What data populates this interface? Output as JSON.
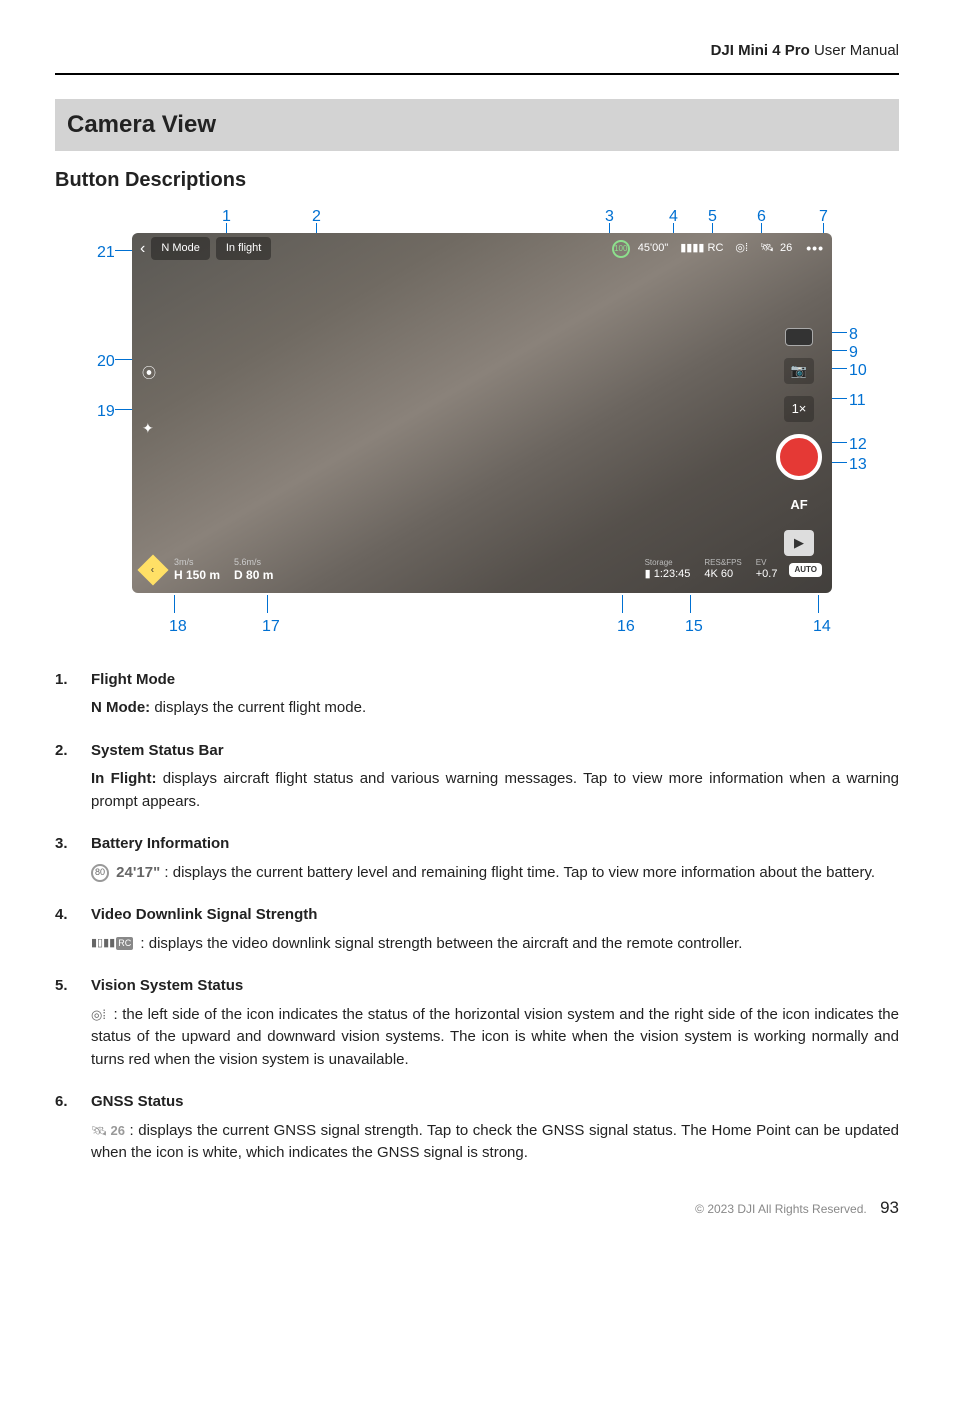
{
  "header": {
    "product": "DJI Mini 4 Pro",
    "label": "User Manual"
  },
  "section_title": "Camera View",
  "sub_title": "Button Descriptions",
  "screenshot": {
    "mode": "N Mode",
    "status": "In flight",
    "battery_pct": "100",
    "battery_time": "45'00\"",
    "gnss": "26",
    "zoom": "1×",
    "af": "AF",
    "speed_v": "3m/s",
    "speed_h": "5.6m/s",
    "height": "H 150 m",
    "distance": "D 80 m",
    "storage_lbl": "Storage",
    "storage_val": "1:23:45",
    "resfps_lbl": "RES&FPS",
    "resfps_val": "4K 60",
    "ev_lbl": "EV",
    "ev_val": "+0.7",
    "auto": "AUTO"
  },
  "callouts": {
    "c1": "1",
    "c2": "2",
    "c3": "3",
    "c4": "4",
    "c5": "5",
    "c6": "6",
    "c7": "7",
    "c8": "8",
    "c9": "9",
    "c10": "10",
    "c11": "11",
    "c12": "12",
    "c13": "13",
    "c14": "14",
    "c15": "15",
    "c16": "16",
    "c17": "17",
    "c18": "18",
    "c19": "19",
    "c20": "20",
    "c21": "21"
  },
  "items": [
    {
      "title": "Flight Mode",
      "bold_prefix": "N Mode:",
      "body": " displays the current flight mode."
    },
    {
      "title": "System Status Bar",
      "bold_prefix": "In Flight:",
      "body": " displays aircraft flight status and various warning messages. Tap to view more information when a warning prompt appears."
    },
    {
      "title": "Battery Information",
      "icon_label": "80",
      "icon_suffix": " 24'17\"",
      "body": " : displays the current battery level and remaining flight time. Tap to view more information about the battery."
    },
    {
      "title": "Video Downlink Signal Strength",
      "icon_glyph": "📶RC",
      "body": " : displays the video downlink signal strength between the aircraft and the remote controller."
    },
    {
      "title": "Vision System Status",
      "icon_glyph": "◎⁞",
      "body": " : the left side of the icon indicates the status of the horizontal vision system and the right side of the icon indicates the status of the upward and downward vision systems. The icon is white when the vision system is working normally and turns red when the vision system is unavailable."
    },
    {
      "title": "GNSS Status",
      "icon_glyph": "🛰",
      "icon_num": "26",
      "body": " : displays the current GNSS signal strength. Tap to check the GNSS signal status. The Home Point can be updated when the icon is white, which indicates the GNSS signal is strong."
    }
  ],
  "footer": {
    "copyright": "© 2023 DJI All Rights Reserved.",
    "page": "93"
  }
}
